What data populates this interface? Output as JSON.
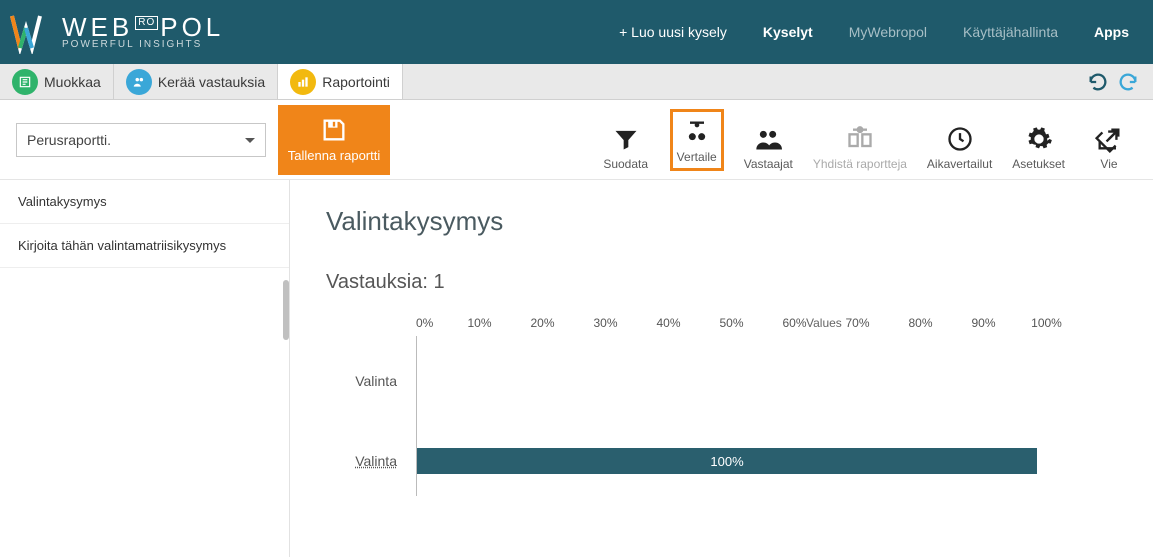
{
  "brand": {
    "name": "WEBROPOL",
    "tagline": "POWERFUL INSIGHTS",
    "ro": "RO"
  },
  "topnav": {
    "create": "+ Luo uusi kysely",
    "surveys": "Kyselyt",
    "my": "MyWebropol",
    "admin": "Käyttäjähallinta",
    "apps": "Apps"
  },
  "tabs": {
    "edit": "Muokkaa",
    "collect": "Kerää vastauksia",
    "report": "Raportointi"
  },
  "toolbar": {
    "dropdown_value": "Perusraportti.",
    "save": "Tallenna raportti",
    "filter": "Suodata",
    "compare": "Vertaile",
    "respondents": "Vastaajat",
    "merge": "Yhdistä raportteja",
    "timecompare": "Aikavertailut",
    "settings": "Asetukset",
    "export": "Vie"
  },
  "sidebar": {
    "items": [
      {
        "label": "Valintakysymys"
      },
      {
        "label": "Kirjoita tähän valintamatriisikysymys"
      }
    ]
  },
  "content": {
    "question_title": "Valintakysymys",
    "answers_label": "Vastauksia:",
    "answers_count": "1",
    "values_label": "Values"
  },
  "chart_data": {
    "type": "bar",
    "orientation": "horizontal",
    "categories": [
      "Valinta",
      "Valinta"
    ],
    "values": [
      0,
      100
    ],
    "value_labels": [
      "",
      "100%"
    ],
    "xlabel": "Values",
    "xlim": [
      0,
      100
    ],
    "ticks": [
      "0%",
      "10%",
      "20%",
      "30%",
      "40%",
      "50%",
      "60%",
      "70%",
      "80%",
      "90%",
      "100%"
    ]
  }
}
